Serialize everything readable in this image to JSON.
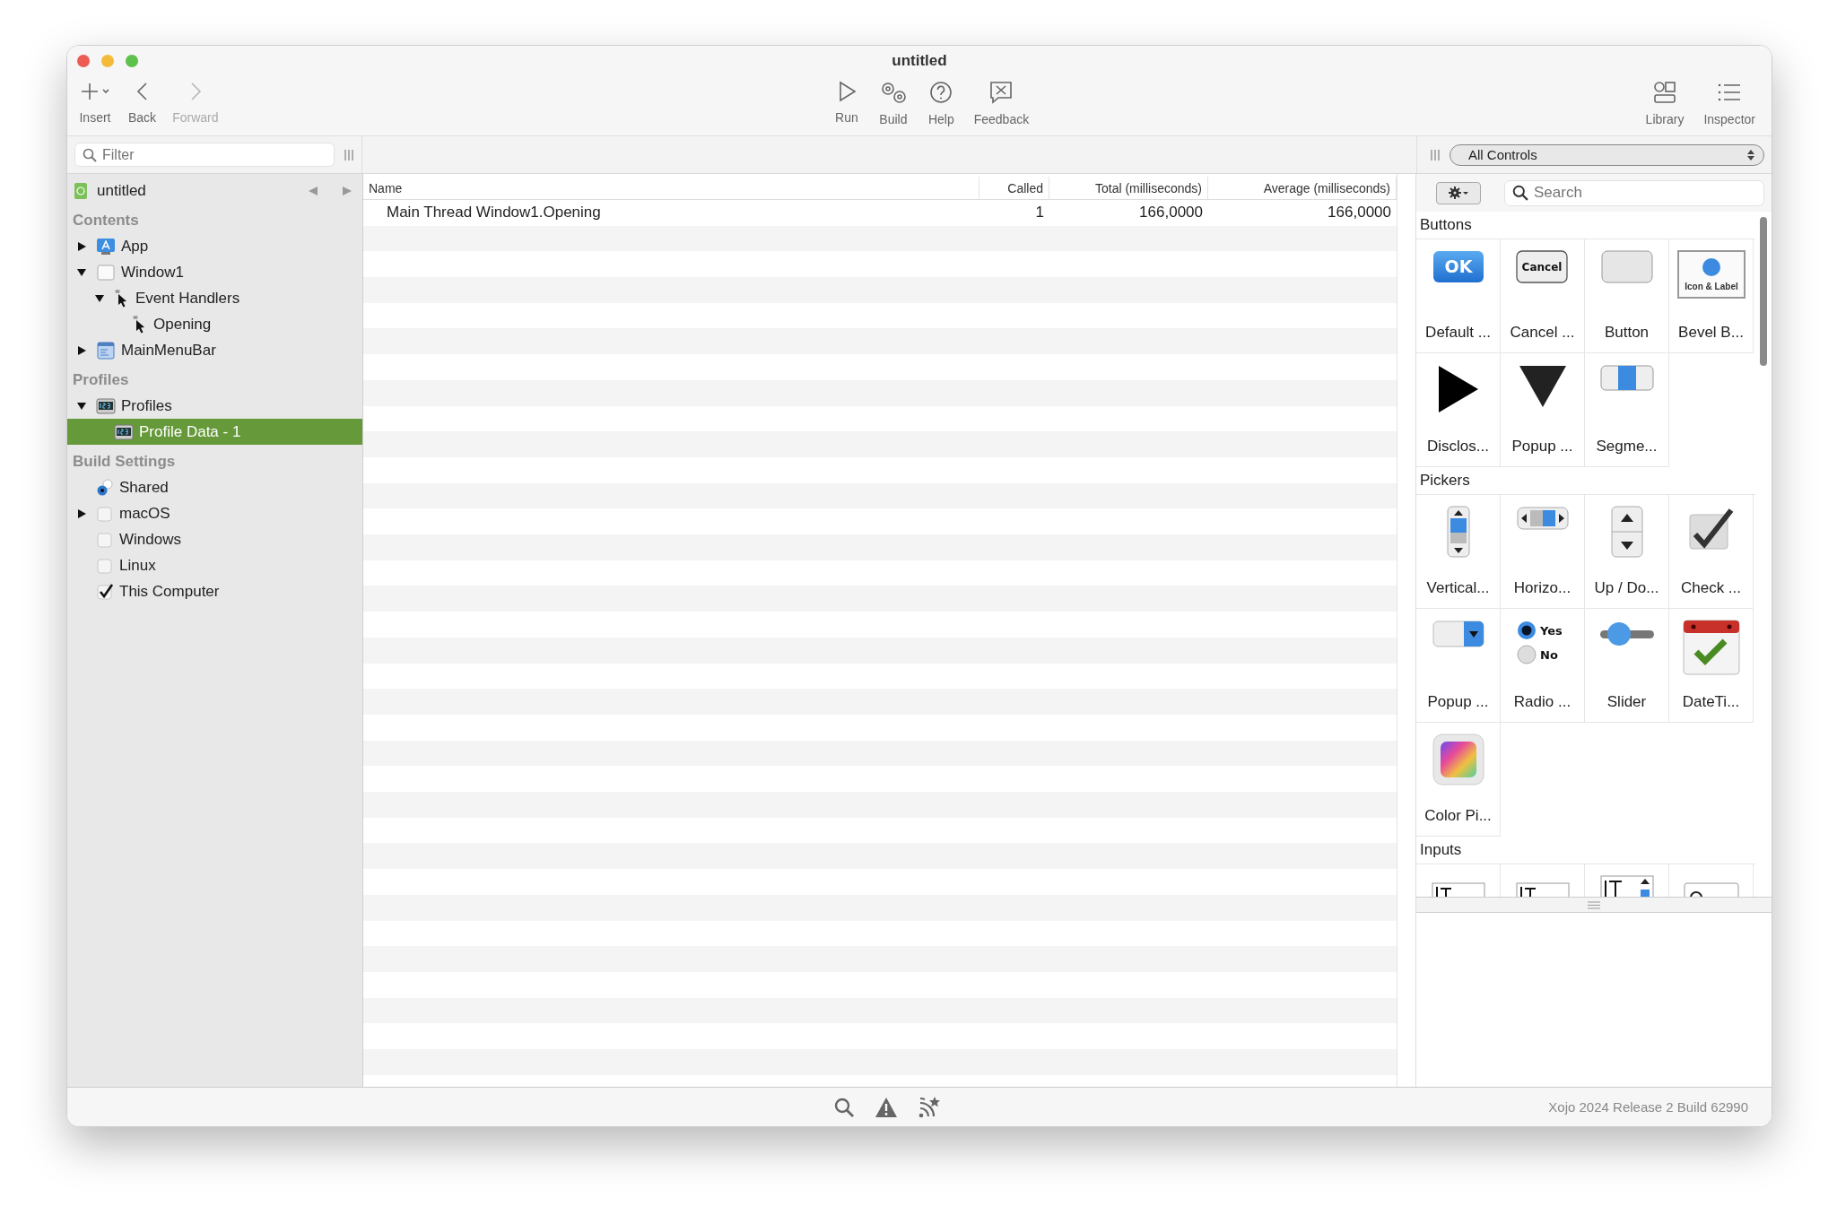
{
  "window": {
    "title": "untitled"
  },
  "toolbar": {
    "left": [
      {
        "label": "Insert",
        "kind": "plus",
        "disabled": false
      },
      {
        "label": "Back",
        "kind": "back",
        "disabled": false
      },
      {
        "label": "Forward",
        "kind": "forward",
        "disabled": true
      }
    ],
    "center": [
      {
        "label": "Run",
        "kind": "run",
        "disabled": false
      },
      {
        "label": "Build",
        "kind": "build",
        "disabled": false
      },
      {
        "label": "Help",
        "kind": "help",
        "disabled": false
      },
      {
        "label": "Feedback",
        "kind": "feedback",
        "disabled": false
      }
    ],
    "right": [
      {
        "label": "Library",
        "kind": "library",
        "disabled": false
      },
      {
        "label": "Inspector",
        "kind": "inspector",
        "disabled": false
      }
    ]
  },
  "sidebar": {
    "filter": {
      "placeholder": "Filter"
    },
    "project": "untitled",
    "sections": [
      {
        "title": "Contents",
        "items": [
          {
            "label": "App",
            "kind": "app",
            "selected": false,
            "expanded": false
          },
          {
            "label": "Window1",
            "kind": "window",
            "selected": false,
            "expanded": true,
            "children": [
              {
                "label": "Event Handlers",
                "kind": "cursor",
                "selected": false,
                "expanded": true,
                "children": [
                  {
                    "label": "Opening",
                    "kind": "cursor",
                    "selected": false
                  }
                ]
              }
            ]
          },
          {
            "label": "MainMenuBar",
            "kind": "menubar",
            "selected": false,
            "expanded": false
          }
        ]
      },
      {
        "title": "Profiles",
        "items": [
          {
            "label": "Profiles",
            "kind": "profile",
            "selected": false,
            "expanded": true,
            "children": [
              {
                "label": "Profile Data - 1",
                "kind": "profile",
                "selected": true
              }
            ]
          }
        ]
      },
      {
        "title": "Build Settings",
        "items": [
          {
            "label": "Shared",
            "kind": "shared",
            "selected": false
          },
          {
            "label": "macOS",
            "kind": "checkbox",
            "checked": false,
            "selected": false,
            "expanded": false
          },
          {
            "label": "Windows",
            "kind": "checkbox",
            "checked": false,
            "selected": false
          },
          {
            "label": "Linux",
            "kind": "checkbox",
            "checked": false,
            "selected": false
          },
          {
            "label": "This Computer",
            "kind": "checkbox",
            "checked": true,
            "selected": false
          }
        ]
      }
    ]
  },
  "table": {
    "columns": [
      "Name",
      "Called",
      "Total (milliseconds)",
      "Average (milliseconds)"
    ],
    "rows": [
      [
        "Main Thread Window1.Opening",
        "1",
        "166,0000",
        "166,0000"
      ]
    ]
  },
  "library": {
    "filter": "All Controls",
    "search": {
      "placeholder": "Search"
    },
    "groups": [
      {
        "title": "Buttons",
        "items": [
          {
            "label": "Default ...",
            "kind": "ok",
            "icon_text": [
              "OK"
            ]
          },
          {
            "label": "Cancel ...",
            "kind": "cancel",
            "icon_text": [
              "Cancel"
            ]
          },
          {
            "label": "Button",
            "kind": "plain"
          },
          {
            "label": "Bevel B...",
            "kind": "bevel",
            "icon_text": [
              "Icon & Label"
            ]
          },
          {
            "label": "Disclos...",
            "kind": "disclosure"
          },
          {
            "label": "Popup ...",
            "kind": "popup-arrow"
          },
          {
            "label": "Segme...",
            "kind": "segmented"
          }
        ]
      },
      {
        "title": "Pickers",
        "items": [
          {
            "label": "Vertical...",
            "kind": "vscroll"
          },
          {
            "label": "Horizo...",
            "kind": "hscroll"
          },
          {
            "label": "Up / Do...",
            "kind": "updown"
          },
          {
            "label": "Check ...",
            "kind": "check"
          },
          {
            "label": "Popup ...",
            "kind": "popup-menu"
          },
          {
            "label": "Radio ...",
            "kind": "radio",
            "icon_text": [
              "Yes",
              "No"
            ]
          },
          {
            "label": "Slider",
            "kind": "slider"
          },
          {
            "label": "DateTi...",
            "kind": "datetime"
          },
          {
            "label": "Color Pi...",
            "kind": "color"
          }
        ]
      },
      {
        "title": "Inputs",
        "items": [
          {
            "kind": "textfield"
          },
          {
            "kind": "textarea"
          },
          {
            "kind": "spinfield"
          },
          {
            "kind": "searchfield"
          }
        ]
      }
    ]
  },
  "status_bar": {
    "version": "Xojo 2024 Release 2 Build 62990"
  }
}
